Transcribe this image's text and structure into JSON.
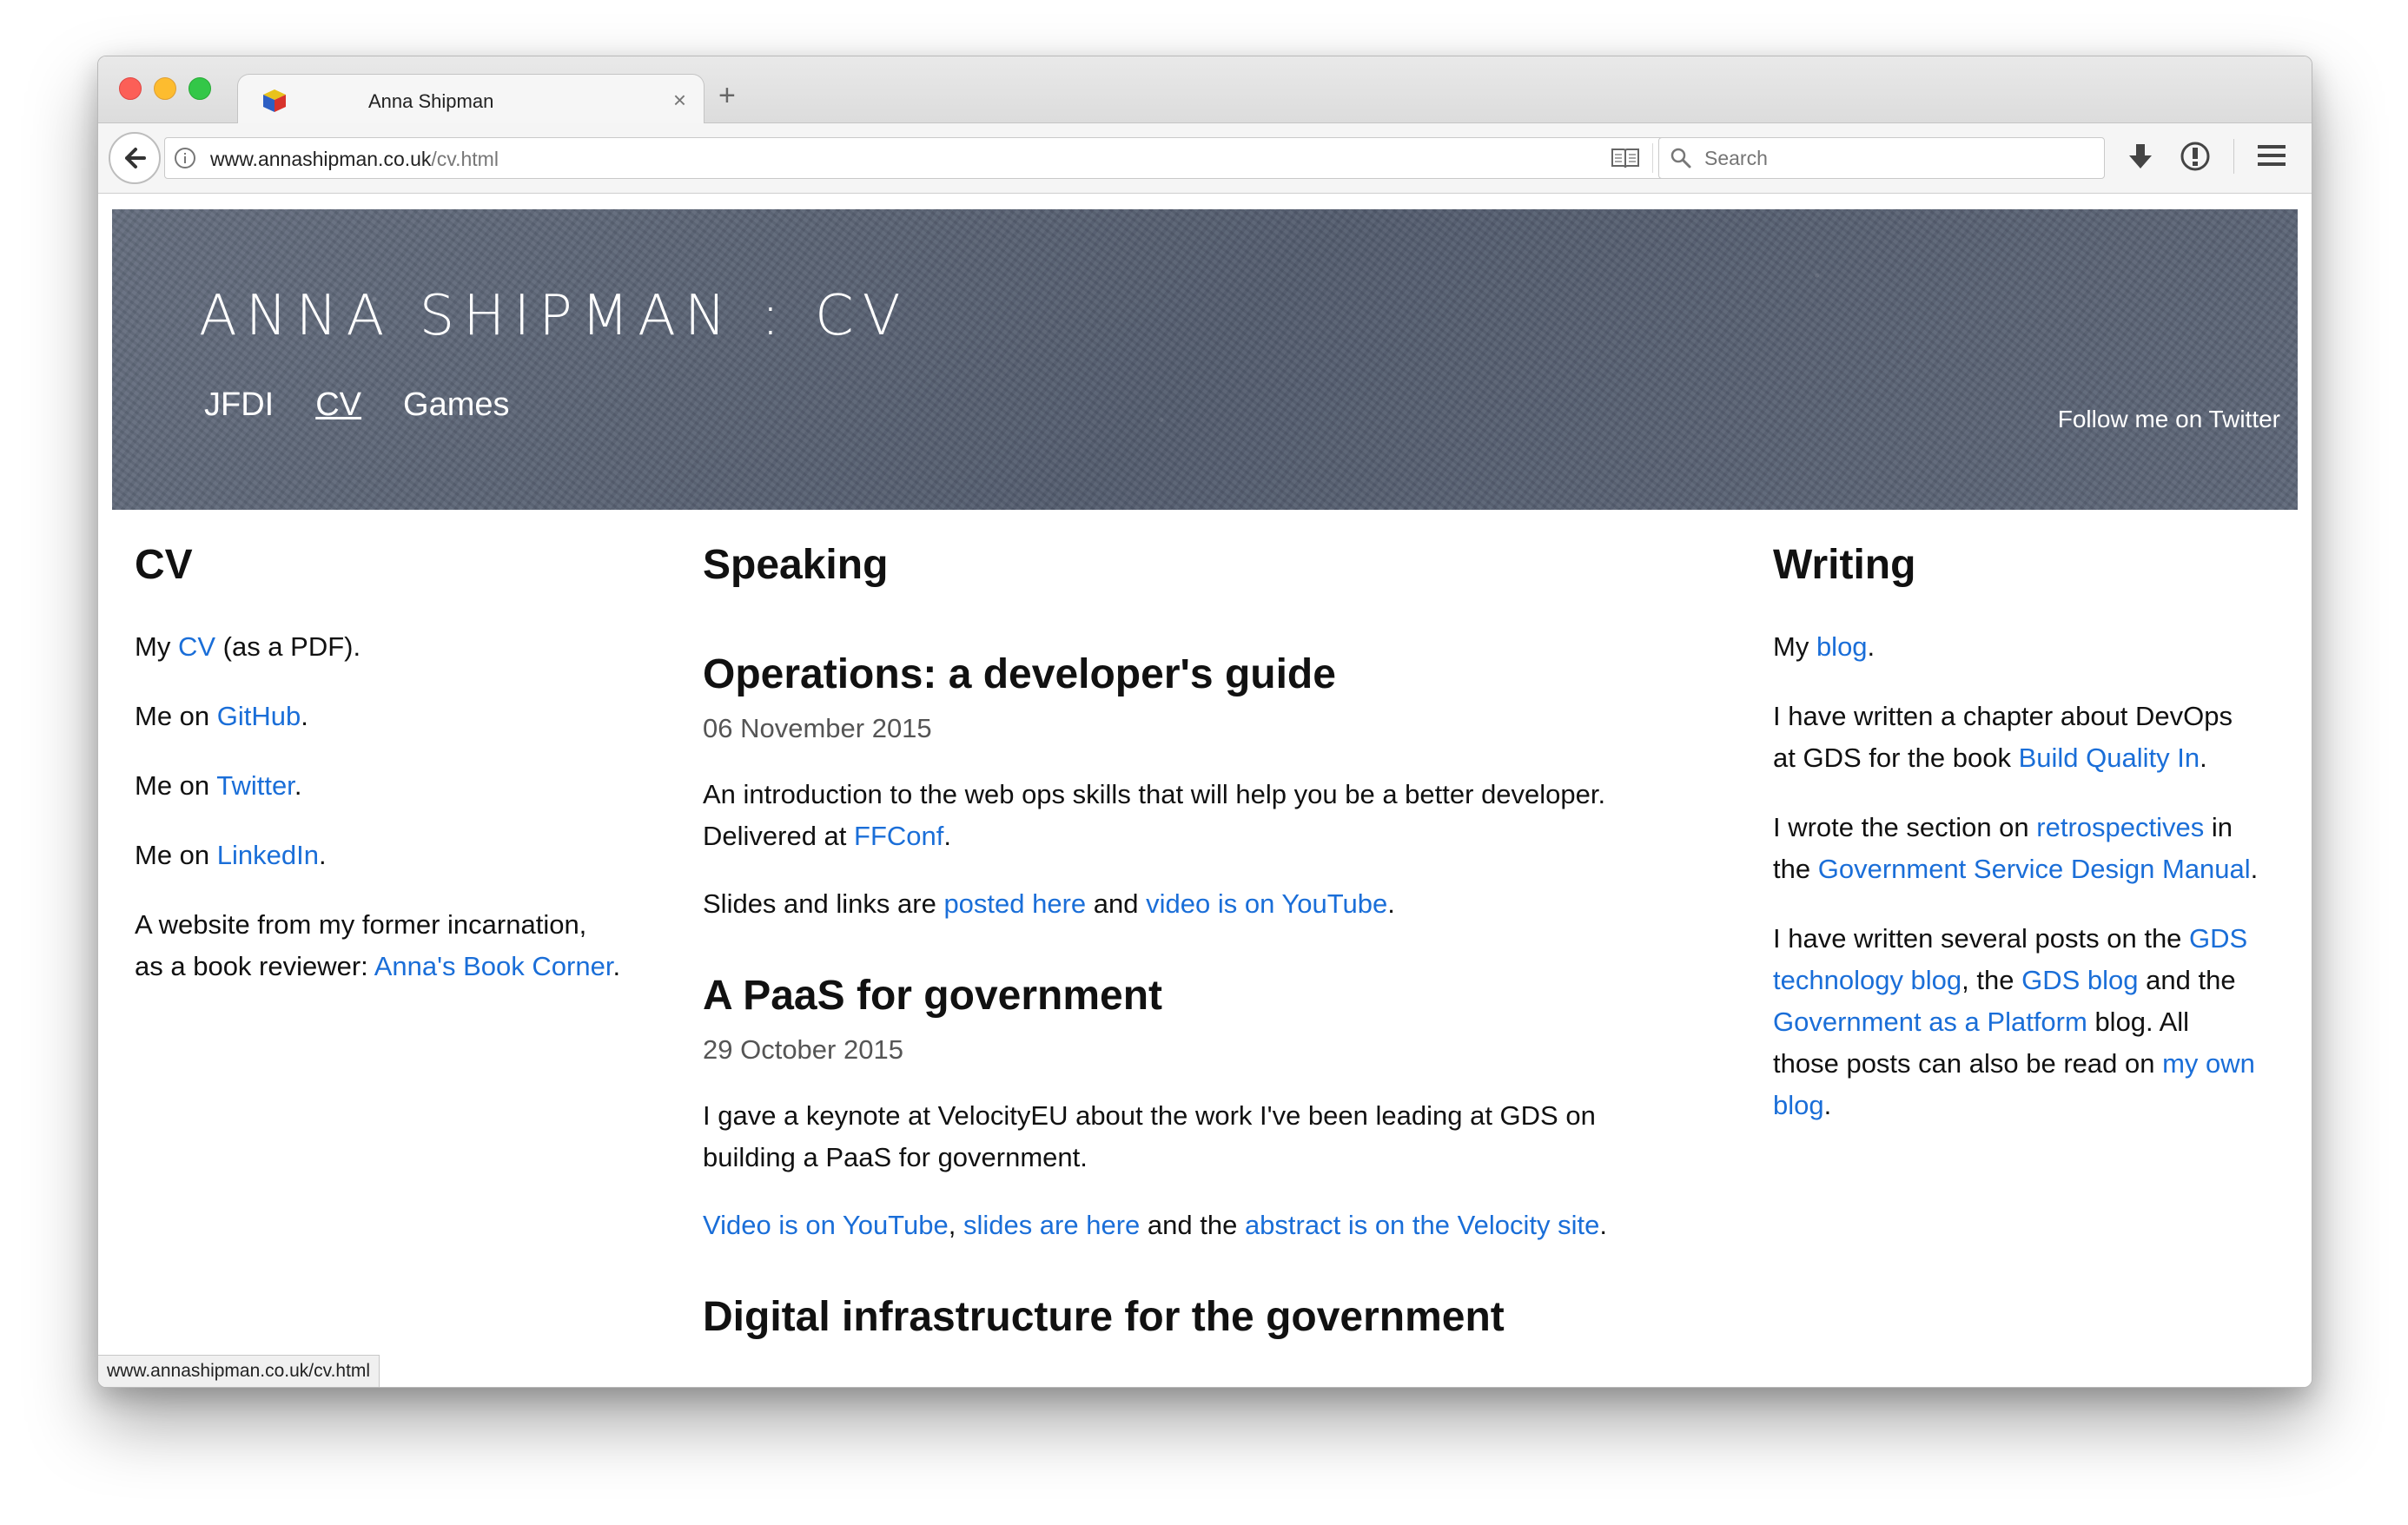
{
  "browser": {
    "tab_title": "Anna Shipman",
    "tab_close": "×",
    "new_tab": "+",
    "url_host": "www.annashipman.co.uk",
    "url_path": "/cv.html",
    "search_placeholder": "Search",
    "status_url": "www.annashipman.co.uk/cv.html"
  },
  "banner": {
    "title": "ANNA SHIPMAN : CV",
    "nav": [
      "JFDI",
      "CV",
      "Games"
    ],
    "active_nav": "CV",
    "follow": "Follow me on Twitter"
  },
  "cv": {
    "heading": "CV",
    "p1": {
      "pre": "My ",
      "link": "CV",
      "post": " (as a PDF)."
    },
    "p2": {
      "pre": "Me on ",
      "link": "GitHub",
      "post": "."
    },
    "p3": {
      "pre": "Me on ",
      "link": "Twitter",
      "post": "."
    },
    "p4": {
      "pre": "Me on ",
      "link": "LinkedIn",
      "post": "."
    },
    "p5": {
      "pre": "A website from my former incarnation, as a book reviewer: ",
      "link": "Anna's Book Corner",
      "post": "."
    }
  },
  "speaking": {
    "heading": "Speaking",
    "talks": [
      {
        "title": "Operations: a developer's guide",
        "date": "06 November 2015",
        "desc_pre": "An introduction to the web ops skills that will help you be a better developer. Delivered at ",
        "desc_link": "FFConf",
        "desc_post": ".",
        "links_pre": "Slides and links are ",
        "link1": "posted here",
        "mid": " and ",
        "link2": "video is on YouTube",
        "links_post": "."
      },
      {
        "title": "A PaaS for government",
        "date": "29 October 2015",
        "desc": "I gave a keynote at VelocityEU about the work I've been leading at GDS on building a PaaS for government.",
        "link1": "Video is on YouTube",
        "sep": ", ",
        "link2": "slides are here",
        "mid": " and the ",
        "link3": "abstract is on the Velocity site",
        "links_post": "."
      },
      {
        "title": "Digital infrastructure for the government"
      }
    ]
  },
  "writing": {
    "heading": "Writing",
    "p1": {
      "pre": "My ",
      "link": "blog",
      "post": "."
    },
    "p2": {
      "pre": "I have written a chapter about DevOps at GDS for the book ",
      "link": "Build Quality In",
      "post": "."
    },
    "p3": {
      "pre": "I wrote the section on ",
      "link1": "retrospectives",
      "mid": " in the ",
      "link2": "Government Service Design Manual",
      "post": "."
    },
    "p4": {
      "pre": "I have written several posts on the ",
      "link1": "GDS technology blog",
      "mid1": ", the ",
      "link2": "GDS blog",
      "mid2": " and the ",
      "link3": "Government as a Platform",
      "mid3": " blog. All those posts can also be read on ",
      "link4": "my own blog",
      "post": "."
    }
  }
}
